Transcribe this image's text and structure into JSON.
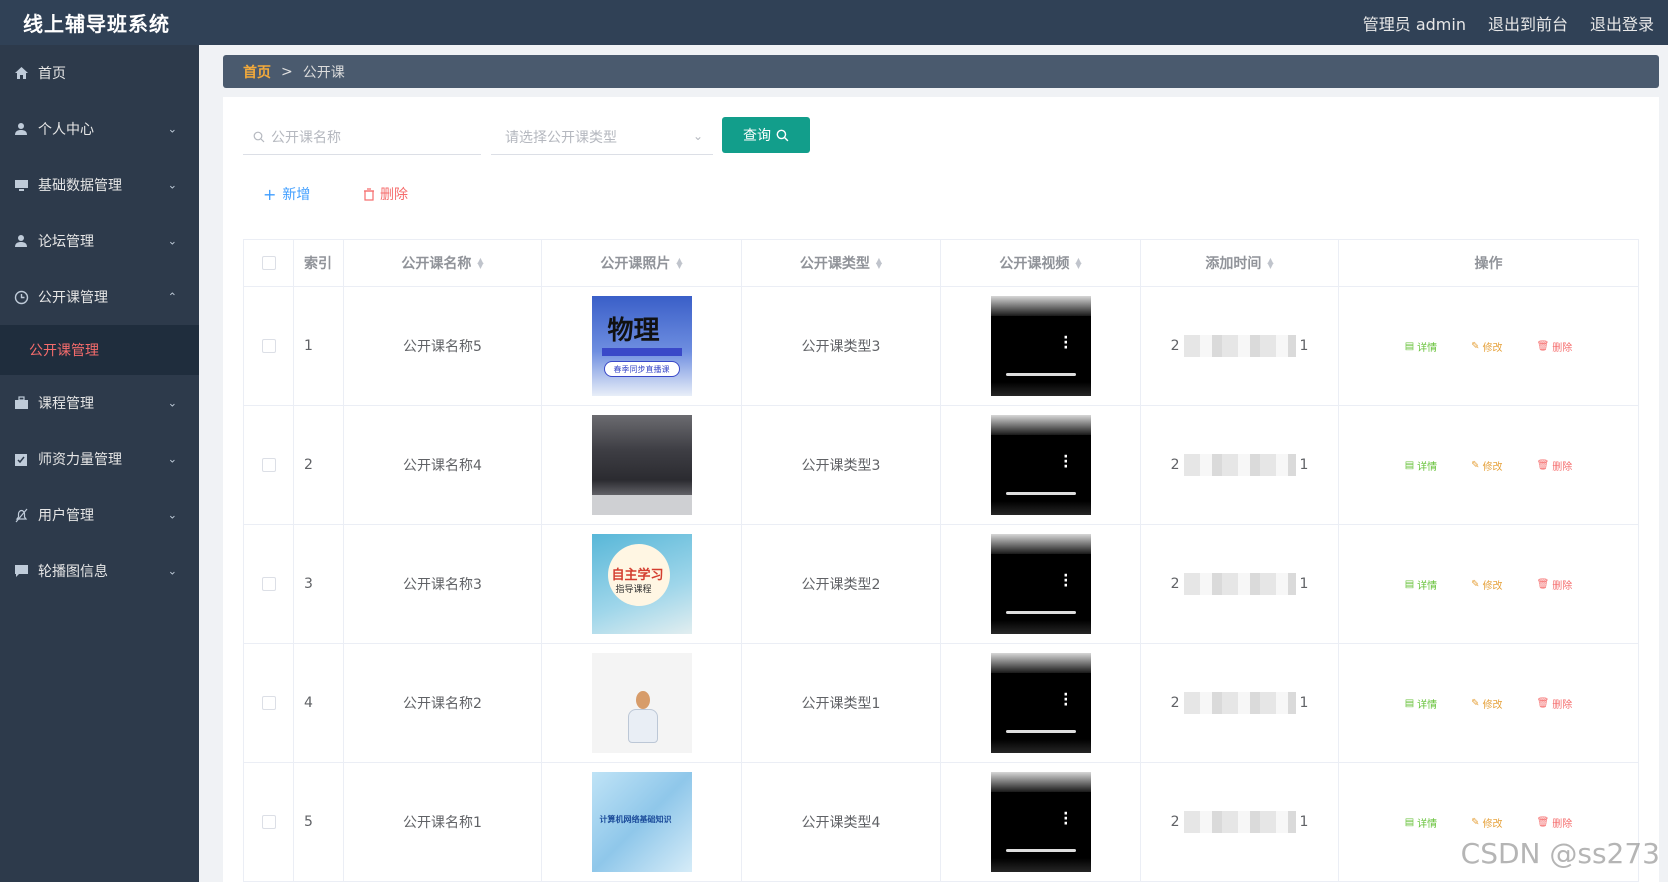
{
  "header": {
    "title": "线上辅导班系统",
    "links": [
      "管理员 admin",
      "退出到前台",
      "退出登录"
    ]
  },
  "sidebar": {
    "items": [
      {
        "label": "首页",
        "icon": "home-icon",
        "has_chevron": false
      },
      {
        "label": "个人中心",
        "icon": "user-icon",
        "has_chevron": true
      },
      {
        "label": "基础数据管理",
        "icon": "monitor-icon",
        "has_chevron": true
      },
      {
        "label": "论坛管理",
        "icon": "user-icon",
        "has_chevron": true
      },
      {
        "label": "公开课管理",
        "icon": "clock-icon",
        "has_chevron": true,
        "expanded": true
      },
      {
        "label": "课程管理",
        "icon": "briefcase-icon",
        "has_chevron": true
      },
      {
        "label": "师资力量管理",
        "icon": "clipboard-check-icon",
        "has_chevron": true
      },
      {
        "label": "用户管理",
        "icon": "bell-off-icon",
        "has_chevron": true
      },
      {
        "label": "轮播图信息",
        "icon": "chat-icon",
        "has_chevron": true
      }
    ],
    "submenu": {
      "label": "公开课管理"
    }
  },
  "breadcrumb": {
    "home": "首页",
    "separator": ">",
    "current": "公开课"
  },
  "search": {
    "name_placeholder": "公开课名称",
    "type_placeholder": "请选择公开课类型",
    "query_label": "查询"
  },
  "actions": {
    "add_label": "新增",
    "delete_label": "删除"
  },
  "table": {
    "headers": {
      "index": "索引",
      "name": "公开课名称",
      "photo": "公开课照片",
      "type": "公开课类型",
      "video": "公开课视频",
      "time": "添加时间",
      "ops": "操作"
    },
    "rows": [
      {
        "index": "1",
        "name": "公开课名称5",
        "type": "公开课类型3",
        "time_start": "2",
        "time_end": "1",
        "photo_text": "物理",
        "photo_sub": "春季同步直播课"
      },
      {
        "index": "2",
        "name": "公开课名称4",
        "type": "公开课类型3",
        "time_start": "2",
        "time_end": "1"
      },
      {
        "index": "3",
        "name": "公开课名称3",
        "type": "公开课类型2",
        "time_start": "2",
        "time_end": "1",
        "photo_text": "自主学习",
        "photo_sub": "指导课程"
      },
      {
        "index": "4",
        "name": "公开课名称2",
        "type": "公开课类型1",
        "time_start": "2",
        "time_end": "1"
      },
      {
        "index": "5",
        "name": "公开课名称1",
        "type": "公开课类型4",
        "time_start": "2",
        "time_end": "1",
        "photo_text": "计算机网络基础知识"
      }
    ],
    "op_labels": {
      "detail": "详情",
      "edit": "修改",
      "delete": "删除"
    }
  },
  "watermark": "CSDN @ss273",
  "colors": {
    "header_bg": "#304156",
    "sidebar_bg": "#2d3a4b",
    "accent": "#129e8b",
    "active_menu": "#f56c6c"
  }
}
